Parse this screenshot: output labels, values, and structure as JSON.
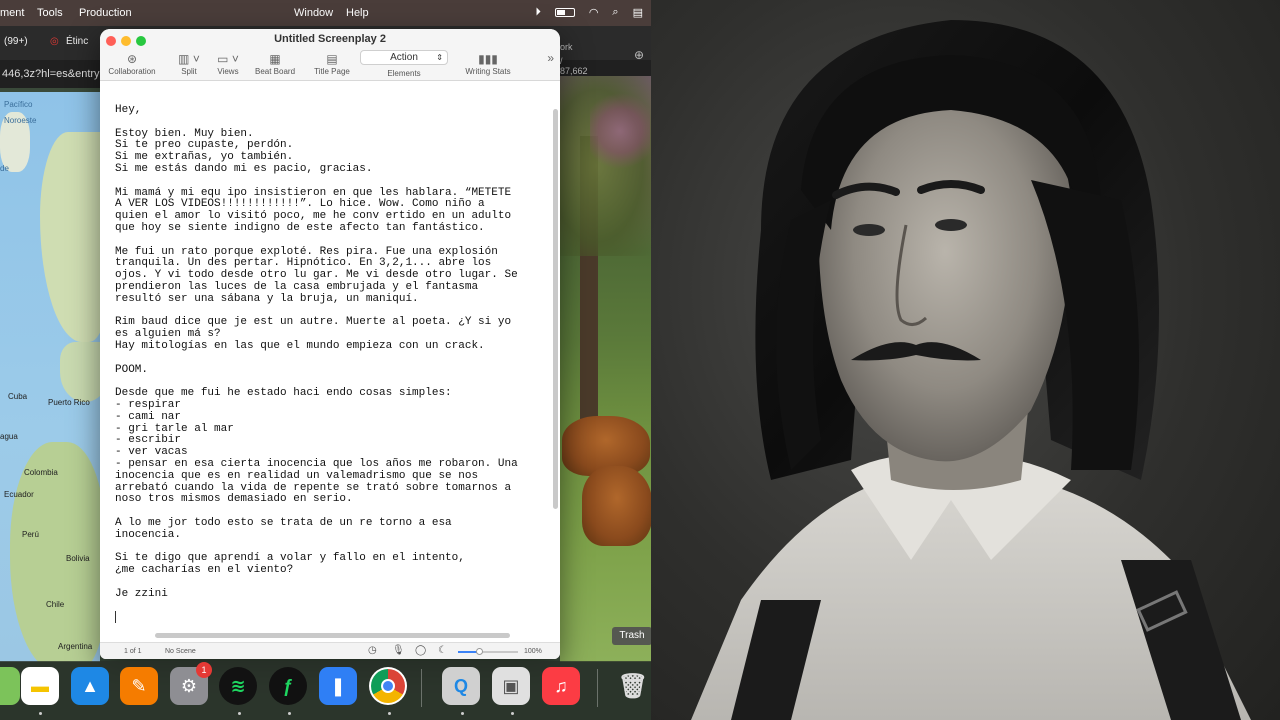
{
  "menubar": {
    "items": [
      "ment",
      "Tools",
      "Production",
      "Window",
      "Help"
    ]
  },
  "browser": {
    "tab_count": "(99+)",
    "tab_label": "Étinc",
    "url_fragment": "446,3z?hl=es&entry=",
    "right_text_1": "ork",
    "right_text_2": "/ 87,662"
  },
  "map": {
    "labels": [
      "Pacífico",
      "Noroeste",
      "de",
      "Cuba",
      "Puerto Rico",
      "agua",
      "Colombia",
      "Ecuador",
      "Perú",
      "Bolivia",
      "Chile",
      "Argentina"
    ]
  },
  "finaldraft": {
    "title": "Untitled Screenplay 2",
    "toolbar": {
      "collaboration": "Collaboration",
      "split": "Split",
      "views": "Views",
      "beat_board": "Beat Board",
      "title_page": "Title Page",
      "element_value": "Action",
      "elements": "Elements",
      "writing_stats": "Writing Stats"
    },
    "script": "Hey,\n\nEstoy bien. Muy bien.\nSi te preo cupaste, perdón.\nSi me extrañas, yo también.\nSi me estás dando mi es pacio, gracias.\n\nMi mamá y mi equ ipo insistieron en que les hablara. “METETE\nA VER LOS VIDEOS!!!!!!!!!!!!”. Lo hice. Wow. Como niño a\nquien el amor lo visitó poco, me he conv ertido en un adulto\nque hoy se siente indigno de este afecto tan fantástico.\n\nMe fui un rato porque exploté. Res pira. Fue una explosión\ntranquila. Un des pertar. Hipnótico. En 3,2,1... abre los\nojos. Y vi todo desde otro lu gar. Me vi desde otro lugar. Se\nprendieron las luces de la casa embrujada y el fantasma\nresultó ser una sábana y la bruja, un maniquí.\n\nRim baud dice que je est un autre. Muerte al poeta. ¿Y si yo\nes alguien má s?\nHay mitologías en las que el mundo empieza con un crack.\n\nPOOM.\n\nDesde que me fui he estado haci endo cosas simples:\n- respirar\n- cami nar\n- gri tarle al mar\n- escribir\n- ver vacas\n- pensar en esa cierta inocencia que los años me robaron. Una\ninocencia que es en realidad un valemadrismo que se nos\narrebató cuando la vida de repente se trató sobre tomarnos a\nnoso tros mismos demasiado en serio.\n\nA lo me jor todo esto se trata de un re torno a esa\ninocencia.\n\nSi te digo que aprendí a volar y fallo en el intento,\n¿me cacharías en el viento?\n\nJe zzini",
    "status": {
      "page": "1 of 1",
      "scene": "No Scene",
      "zoom": "100%",
      "zoom_fraction": 0.35
    }
  },
  "dock": {
    "trash_tooltip": "Trash",
    "settings_badge": "1"
  }
}
